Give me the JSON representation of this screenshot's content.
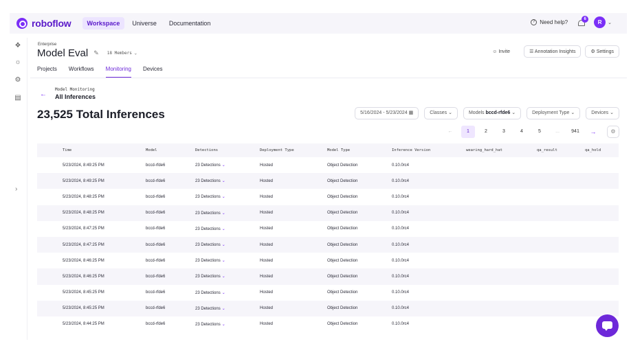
{
  "brand": {
    "name": "roboflow",
    "accent": "#7b2ff7"
  },
  "nav": {
    "items": [
      "Workspace",
      "Universe",
      "Documentation"
    ],
    "active": "Workspace"
  },
  "top_right": {
    "help": "Need help?",
    "notifications": "6",
    "avatar": "R"
  },
  "header": {
    "workspace": "Enterprise",
    "project": "Model Eval",
    "members": "18 Members",
    "invite": "Invite",
    "insights": "Annotation Insights",
    "settings": "Settings"
  },
  "tabs": [
    "Projects",
    "Workflows",
    "Monitoring",
    "Devices"
  ],
  "section": {
    "crumb": "Model Monitoring",
    "title": "All Inferences"
  },
  "total": "23,525 Total Inferences",
  "filters": {
    "date": "5/16/2024 - 5/23/2024",
    "classes": "Classes",
    "models_label": "Models",
    "models_value": "bccd-rfde6",
    "deployment": "Deployment Type",
    "devices": "Devices"
  },
  "pager": {
    "pages": [
      "1",
      "2",
      "3",
      "4",
      "5",
      "...",
      "941"
    ]
  },
  "table": {
    "columns": [
      "Time",
      "Model",
      "Detections",
      "Deployment Type",
      "Model Type",
      "Inference Version",
      "wearing_hard_hat",
      "qa_result",
      "qa_hold"
    ],
    "rows": [
      [
        "5/23/2024, 8:49:25 PM",
        "bccd-rfde6",
        "23 Detections",
        "Hosted",
        "Object Detection",
        "0.10.0rc4"
      ],
      [
        "5/23/2024, 8:49:25 PM",
        "bccd-rfde6",
        "23 Detections",
        "Hosted",
        "Object Detection",
        "0.10.0rc4"
      ],
      [
        "5/23/2024, 8:48:25 PM",
        "bccd-rfde6",
        "23 Detections",
        "Hosted",
        "Object Detection",
        "0.10.0rc4"
      ],
      [
        "5/23/2024, 8:48:25 PM",
        "bccd-rfde6",
        "23 Detections",
        "Hosted",
        "Object Detection",
        "0.10.0rc4"
      ],
      [
        "5/23/2024, 8:47:25 PM",
        "bccd-rfde6",
        "23 Detections",
        "Hosted",
        "Object Detection",
        "0.10.0rc4"
      ],
      [
        "5/23/2024, 8:47:25 PM",
        "bccd-rfde6",
        "23 Detections",
        "Hosted",
        "Object Detection",
        "0.10.0rc4"
      ],
      [
        "5/23/2024, 8:46:25 PM",
        "bccd-rfde6",
        "23 Detections",
        "Hosted",
        "Object Detection",
        "0.10.0rc4"
      ],
      [
        "5/23/2024, 8:46:25 PM",
        "bccd-rfde6",
        "23 Detections",
        "Hosted",
        "Object Detection",
        "0.10.0rc4"
      ],
      [
        "5/23/2024, 8:45:25 PM",
        "bccd-rfde6",
        "23 Detections",
        "Hosted",
        "Object Detection",
        "0.10.0rc4"
      ],
      [
        "5/23/2024, 8:45:25 PM",
        "bccd-rfde6",
        "23 Detections",
        "Hosted",
        "Object Detection",
        "0.10.0rc4"
      ],
      [
        "5/23/2024, 8:44:25 PM",
        "bccd-rfde6",
        "23 Detections",
        "Hosted",
        "Object Detection",
        "0.10.0rc4"
      ]
    ]
  }
}
